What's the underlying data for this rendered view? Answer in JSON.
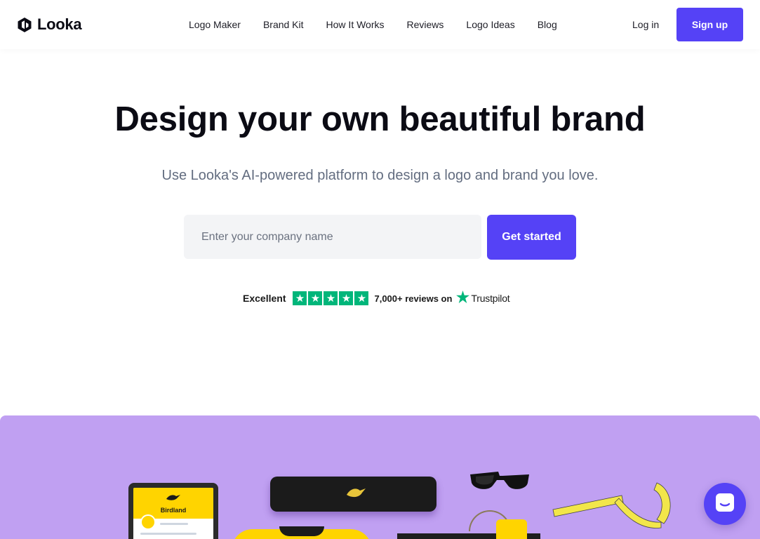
{
  "nav": {
    "brand": "Looka",
    "menu": [
      {
        "label": "Logo Maker"
      },
      {
        "label": "Brand Kit"
      },
      {
        "label": "How It Works"
      },
      {
        "label": "Reviews"
      },
      {
        "label": "Logo Ideas"
      },
      {
        "label": "Blog"
      }
    ],
    "login_label": "Log in",
    "signup_label": "Sign up"
  },
  "hero": {
    "title": "Design your own beautiful brand",
    "subtitle": "Use Looka's AI-powered platform to design a logo and brand you love.",
    "search": {
      "placeholder": "Enter your company name",
      "value": ""
    },
    "cta_label": "Get started"
  },
  "trustpilot": {
    "rating_text": "Excellent",
    "stars": 5,
    "reviews_text": "7,000+ reviews on",
    "brand": "Trustpilot"
  },
  "showcase": {
    "tablet_brand": "Birdland"
  },
  "colors": {
    "accent": "#5542f6",
    "showcase_bg": "#c0a0f2",
    "trustpilot_green": "#00b67a",
    "product_yellow": "#ffd400"
  },
  "icons": {
    "brand_logo": "looka-logo-icon",
    "star": "star-icon",
    "chat": "chat-icon"
  }
}
